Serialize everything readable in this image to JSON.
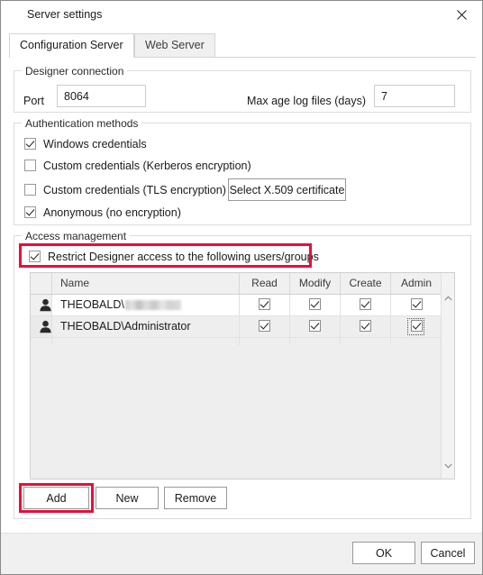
{
  "window": {
    "title": "Server settings",
    "close_icon": "close-icon"
  },
  "tabs": [
    {
      "label": "Configuration Server",
      "active": true
    },
    {
      "label": "Web Server",
      "active": false
    }
  ],
  "designer_connection": {
    "legend": "Designer connection",
    "port_label": "Port",
    "port_value": "8064",
    "max_age_label": "Max age log files (days)",
    "max_age_value": "7"
  },
  "authentication_methods": {
    "legend": "Authentication methods",
    "options": [
      {
        "label": "Windows credentials",
        "checked": true
      },
      {
        "label": "Custom credentials (Kerberos encryption)",
        "checked": false
      },
      {
        "label": "Custom credentials (TLS encryption)",
        "checked": false
      },
      {
        "label": "Anonymous (no encryption)",
        "checked": true
      }
    ],
    "arrow_glyph": "→",
    "certificate_button": "Select X.509 certificate"
  },
  "access_management": {
    "legend": "Access management",
    "restrict_label": "Restrict Designer access to the following users/groups",
    "restrict_checked": true,
    "columns": [
      "Name",
      "Read",
      "Modify",
      "Create",
      "Admin"
    ],
    "rows": [
      {
        "icon": "person-icon",
        "name_prefix": "THEOBALD\\",
        "name_redacted": true,
        "read": true,
        "modify": true,
        "create": true,
        "admin": true,
        "admin_focused": false
      },
      {
        "icon": "person-icon",
        "name_prefix": "THEOBALD\\Administrator",
        "name_redacted": false,
        "read": true,
        "modify": true,
        "create": true,
        "admin": true,
        "admin_focused": true
      }
    ],
    "buttons": {
      "add": "Add",
      "new": "New",
      "remove": "Remove"
    }
  },
  "footer": {
    "ok": "OK",
    "cancel": "Cancel"
  },
  "annotations": {
    "highlight_color": "#ec0c38",
    "highlighted": [
      "restrict-checkbox-row",
      "add-button"
    ]
  }
}
